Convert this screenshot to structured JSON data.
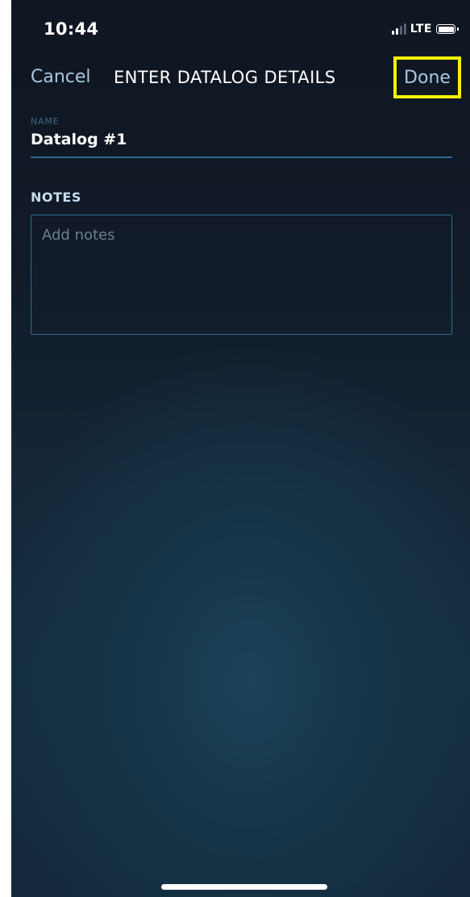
{
  "status_bar": {
    "time": "10:44",
    "network": "LTE",
    "signal_bars_active": 2,
    "signal_bars_total": 4,
    "battery_icon": "battery-full-icon"
  },
  "nav": {
    "cancel_label": "Cancel",
    "title": "ENTER DATALOG DETAILS",
    "done_label": "Done",
    "done_highlight_color": "#f8f200"
  },
  "name_field": {
    "label": "NAME",
    "value": "Datalog #1"
  },
  "notes_field": {
    "label": "NOTES",
    "placeholder": "Add notes"
  },
  "colors": {
    "accent": "#a9c8e0",
    "field_border": "#2f6a92",
    "background_top": "#101621",
    "background_bottom": "#152d40"
  }
}
